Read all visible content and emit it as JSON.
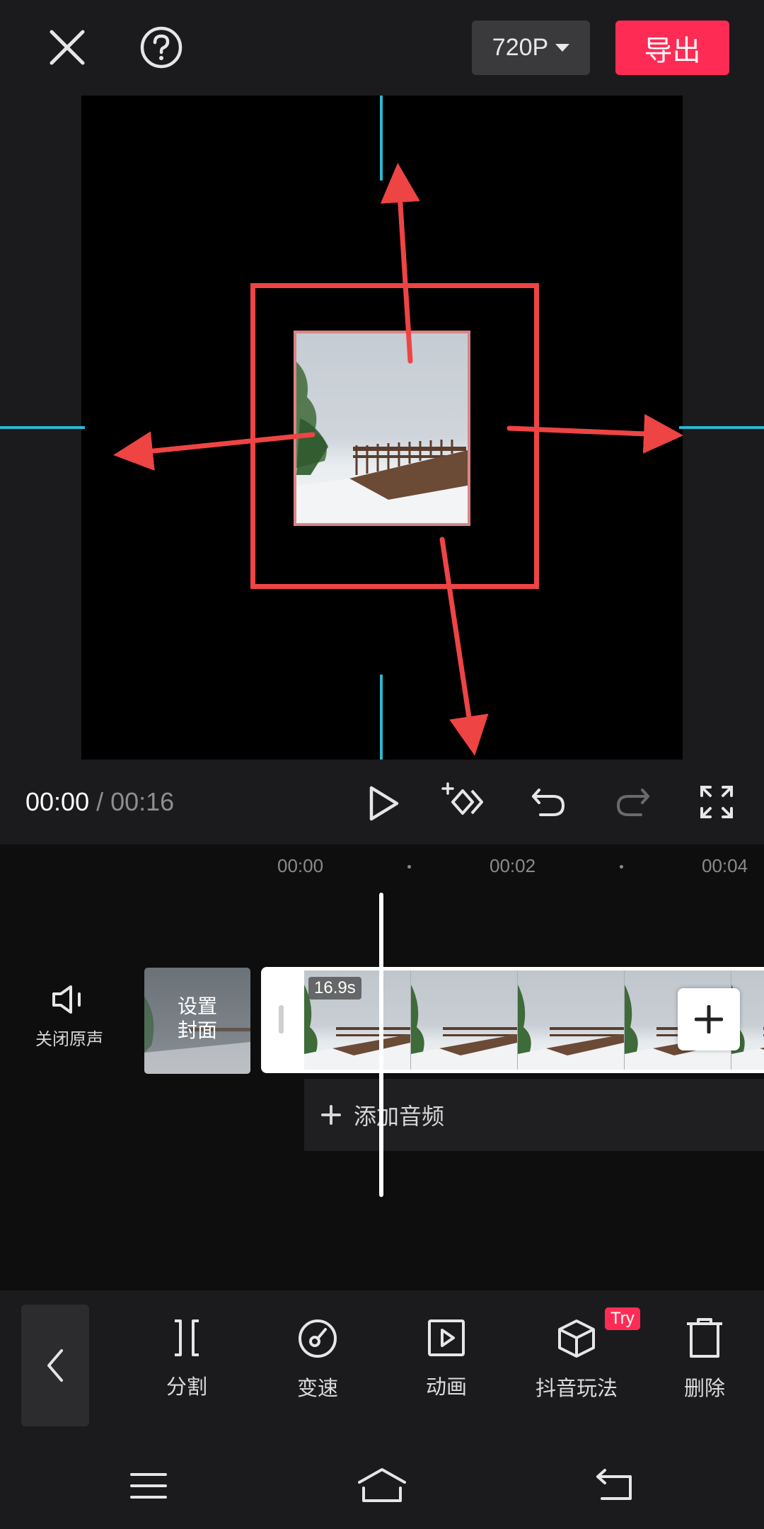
{
  "header": {
    "resolution": "720P",
    "export_label": "导出"
  },
  "playback": {
    "current_time": "00:00",
    "separator": " / ",
    "total_time": "00:16"
  },
  "timeline": {
    "ruler": [
      "00:00",
      "00:02",
      "00:04"
    ],
    "mute_label": "关闭原声",
    "cover_label": "设置\n封面",
    "clip_duration": "16.9s",
    "add_audio_label": "添加音频"
  },
  "toolbar": {
    "items": [
      {
        "label": "分割",
        "icon": "split-icon"
      },
      {
        "label": "变速",
        "icon": "speed-icon"
      },
      {
        "label": "动画",
        "icon": "animation-icon"
      },
      {
        "label": "抖音玩法",
        "icon": "cube-icon"
      },
      {
        "label": "删除",
        "icon": "trash-icon"
      }
    ],
    "try_badge": "Try"
  },
  "colors": {
    "accent": "#fe2c55",
    "guide": "#2ab8cf",
    "annotation": "#ee4444"
  }
}
